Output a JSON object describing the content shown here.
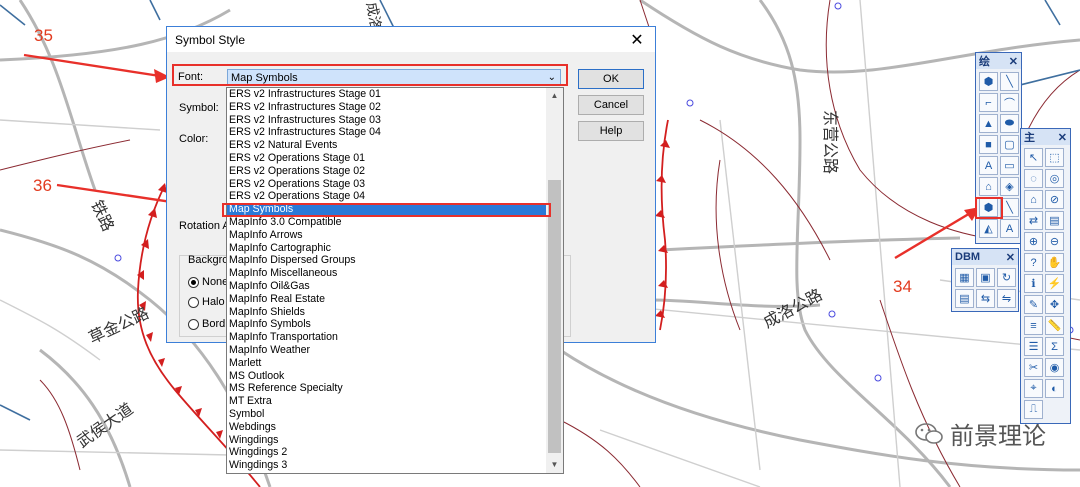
{
  "map": {
    "labels": [
      "铁路",
      "东营公路",
      "成洛公路",
      "草金公路",
      "武侯大道",
      "都江公路",
      "成洛"
    ]
  },
  "annotations": [
    "35",
    "36",
    "34"
  ],
  "watermark": "前景理论",
  "dialog": {
    "title": "Symbol Style",
    "font_label": "Font:",
    "font_value": "Map Symbols",
    "symbol_label": "Symbol:",
    "color_label": "Color:",
    "rotation_label": "Rotation A",
    "background_label": "Backgro",
    "radio": [
      {
        "label": "None",
        "checked": true
      },
      {
        "label": "Halo",
        "checked": false
      },
      {
        "label": "Bord",
        "checked": false
      }
    ],
    "buttons": {
      "ok": "OK",
      "cancel": "Cancel",
      "help": "Help"
    }
  },
  "font_list": {
    "selected_index": 9,
    "items": [
      "ERS v2 Infrastructures Stage 01",
      "ERS v2 Infrastructures Stage 02",
      "ERS v2 Infrastructures Stage 03",
      "ERS v2 Infrastructures Stage 04",
      "ERS v2 Natural Events",
      "ERS v2 Operations Stage 01",
      "ERS v2 Operations Stage 02",
      "ERS v2 Operations Stage 03",
      "ERS v2 Operations Stage 04",
      "Map Symbols",
      "MapInfo 3.0 Compatible",
      "MapInfo Arrows",
      "MapInfo Cartographic",
      "MapInfo Dispersed Groups",
      "MapInfo Miscellaneous",
      "MapInfo Oil&Gas",
      "MapInfo Real Estate",
      "MapInfo Shields",
      "MapInfo Symbols",
      "MapInfo Transportation",
      "MapInfo Weather",
      "Marlett",
      "MS Outlook",
      "MS Reference Specialty",
      "MT Extra",
      "Symbol",
      "Webdings",
      "Wingdings",
      "Wingdings 2",
      "Wingdings 3"
    ]
  },
  "toolbars": {
    "draw": {
      "title": "绘",
      "tools": [
        "symbol-tool",
        "line-tool",
        "polyline-tool",
        "arc-tool",
        "polygon-tool",
        "ellipse-tool",
        "rectangle-tool",
        "rounded-rect-tool",
        "text-tool",
        "frame-tool",
        "add-node-tool",
        "reshape-tool",
        "symbol-style-tool",
        "line-style-tool",
        "region-style-tool",
        "text-style-tool"
      ]
    },
    "main": {
      "title": "主",
      "tools": [
        "select-tool",
        "marquee-select-tool",
        "radius-select-tool",
        "boundary-select-tool",
        "polygon-select-tool",
        "unselect-tool",
        "invert-select-tool",
        "graph-select-tool",
        "zoom-in-tool",
        "zoom-out-tool",
        "change-view-tool",
        "grabber-tool",
        "info-tool",
        "hotlink-tool",
        "label-tool",
        "drag-map-tool",
        "layer-control-tool",
        "ruler-tool",
        "legend-tool",
        "statistics-tool",
        "clip-region-tool",
        "set-target-tool",
        "show-scalebar-tool",
        "hide-tool",
        "scalebar-tool"
      ]
    },
    "dbms": {
      "title": "DBM",
      "tools": [
        "open-table-tool",
        "save-table-tool",
        "refresh-table-tool",
        "sql-tool",
        "connect-tool",
        "disconnect-tool"
      ]
    }
  }
}
